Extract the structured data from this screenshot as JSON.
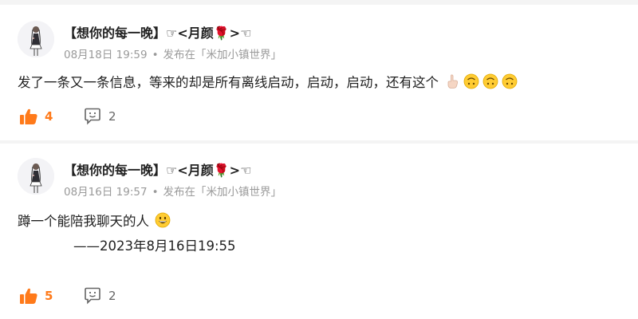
{
  "posts": [
    {
      "username": "【想你的每一晚】☞<月颜🌹>☜",
      "date": "08月18日 19:59",
      "separator": "•",
      "published_in": "发布在「米加小镇世界」",
      "text": "发了一条又一条信息，等来的却是所有离线启动，启动，启动，还有这个",
      "signature": "",
      "likes": "4",
      "comments": "2"
    },
    {
      "username": "【想你的每一晚】☞<月颜🌹>☜",
      "date": "08月16日 19:57",
      "separator": "•",
      "published_in": "发布在「米加小镇世界」",
      "text": "蹲一个能陪我聊天的人",
      "signature": "——2023年8月16日19:55",
      "likes": "5",
      "comments": "2"
    }
  ],
  "colors": {
    "accent": "#ff7a1a",
    "meta": "#9a9a9a",
    "text": "#1f1f1f",
    "divider": "#f4f4f4"
  },
  "icons": {
    "like": "thumbs-up-icon",
    "comment": "comment-bubble-icon",
    "emoji_1": "pointing-down-hand-icon",
    "emoji_2": "upside-down-face-icon",
    "emoji_3": "grinning-face-icon"
  }
}
